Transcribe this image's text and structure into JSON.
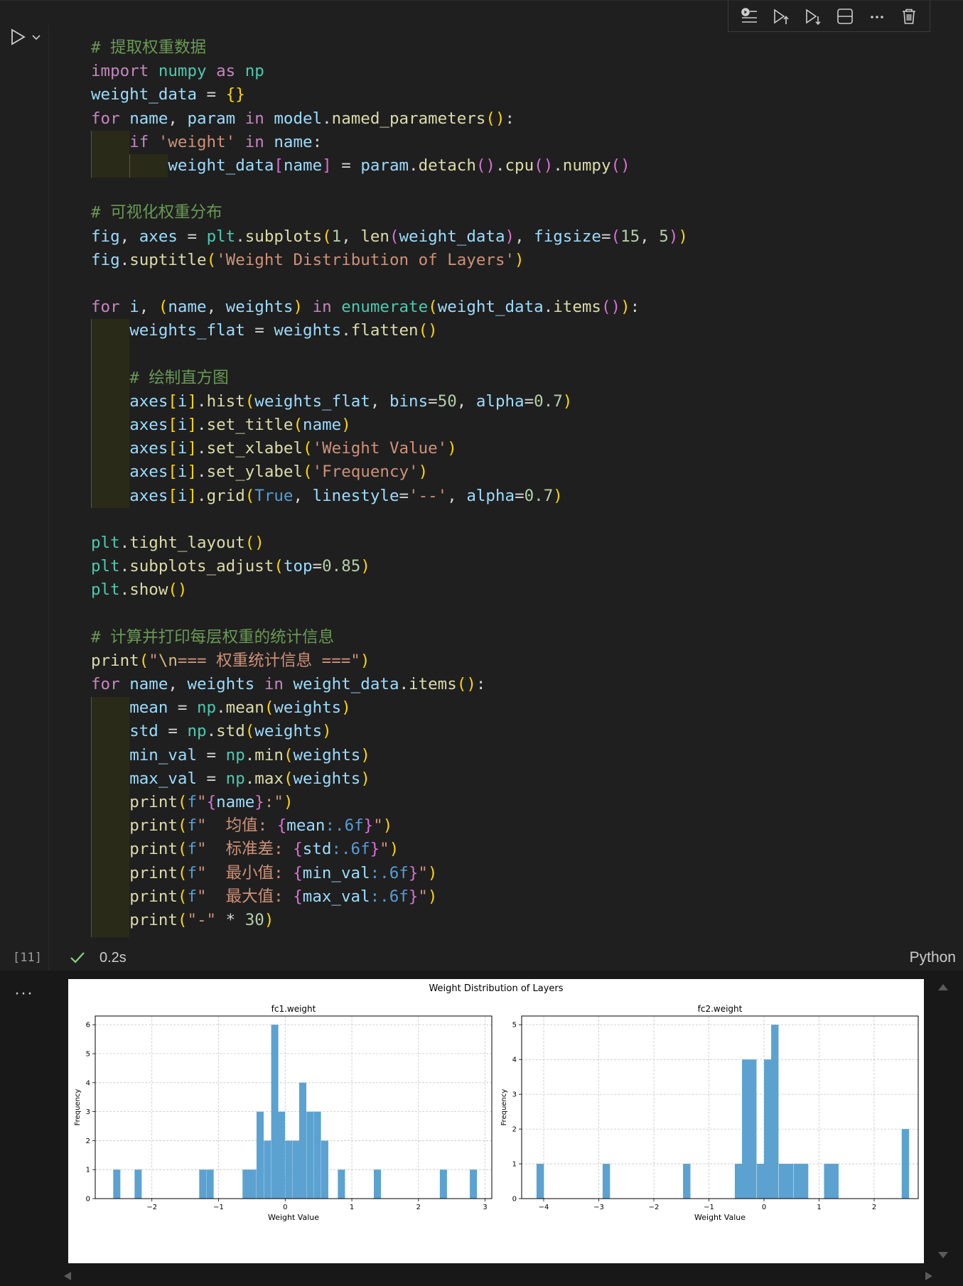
{
  "toolbar": {
    "icons": [
      "run-by-line-icon",
      "execute-above-icon",
      "execute-below-icon",
      "split-cell-icon",
      "more-icon",
      "delete-icon"
    ]
  },
  "code_lines": [
    [
      [
        "cm",
        "# 提取权重数据"
      ]
    ],
    [
      [
        "kw",
        "import"
      ],
      [
        "op",
        " "
      ],
      [
        "mod",
        "numpy"
      ],
      [
        "op",
        " "
      ],
      [
        "kw",
        "as"
      ],
      [
        "op",
        " "
      ],
      [
        "mod",
        "np"
      ]
    ],
    [
      [
        "var",
        "weight_data"
      ],
      [
        "op",
        " = "
      ],
      [
        "p1",
        "{}"
      ]
    ],
    [
      [
        "kw",
        "for"
      ],
      [
        "op",
        " "
      ],
      [
        "var",
        "name"
      ],
      [
        "op",
        ", "
      ],
      [
        "var",
        "param"
      ],
      [
        "op",
        " "
      ],
      [
        "kw",
        "in"
      ],
      [
        "op",
        " "
      ],
      [
        "var",
        "model"
      ],
      [
        "op",
        "."
      ],
      [
        "fn",
        "named_parameters"
      ],
      [
        "p1",
        "()"
      ],
      [
        "op",
        ":"
      ]
    ],
    [
      [
        "op",
        "    "
      ],
      [
        "kw",
        "if"
      ],
      [
        "op",
        " "
      ],
      [
        "str",
        "'weight'"
      ],
      [
        "op",
        " "
      ],
      [
        "kw",
        "in"
      ],
      [
        "op",
        " "
      ],
      [
        "var",
        "name"
      ],
      [
        "op",
        ":"
      ]
    ],
    [
      [
        "op",
        "        "
      ],
      [
        "var",
        "weight_data"
      ],
      [
        "p2",
        "["
      ],
      [
        "var",
        "name"
      ],
      [
        "p2",
        "]"
      ],
      [
        "op",
        " = "
      ],
      [
        "var",
        "param"
      ],
      [
        "op",
        "."
      ],
      [
        "fn",
        "detach"
      ],
      [
        "p2",
        "()"
      ],
      [
        "op",
        "."
      ],
      [
        "fn",
        "cpu"
      ],
      [
        "p2",
        "()"
      ],
      [
        "op",
        "."
      ],
      [
        "fn",
        "numpy"
      ],
      [
        "p2",
        "()"
      ]
    ],
    [],
    [
      [
        "cm",
        "# 可视化权重分布"
      ]
    ],
    [
      [
        "var",
        "fig"
      ],
      [
        "op",
        ", "
      ],
      [
        "var",
        "axes"
      ],
      [
        "op",
        " = "
      ],
      [
        "mod",
        "plt"
      ],
      [
        "op",
        "."
      ],
      [
        "fn",
        "subplots"
      ],
      [
        "p1",
        "("
      ],
      [
        "num",
        "1"
      ],
      [
        "op",
        ", "
      ],
      [
        "fn",
        "len"
      ],
      [
        "p2",
        "("
      ],
      [
        "var",
        "weight_data"
      ],
      [
        "p2",
        ")"
      ],
      [
        "op",
        ", "
      ],
      [
        "var",
        "figsize"
      ],
      [
        "op",
        "="
      ],
      [
        "p2",
        "("
      ],
      [
        "num",
        "15"
      ],
      [
        "op",
        ", "
      ],
      [
        "num",
        "5"
      ],
      [
        "p2",
        ")"
      ],
      [
        "p1",
        ")"
      ]
    ],
    [
      [
        "var",
        "fig"
      ],
      [
        "op",
        "."
      ],
      [
        "fn",
        "suptitle"
      ],
      [
        "p1",
        "("
      ],
      [
        "str",
        "'Weight Distribution of Layers'"
      ],
      [
        "p1",
        ")"
      ]
    ],
    [],
    [
      [
        "kw",
        "for"
      ],
      [
        "op",
        " "
      ],
      [
        "var",
        "i"
      ],
      [
        "op",
        ", "
      ],
      [
        "p1",
        "("
      ],
      [
        "var",
        "name"
      ],
      [
        "op",
        ", "
      ],
      [
        "var",
        "weights"
      ],
      [
        "p1",
        ")"
      ],
      [
        "op",
        " "
      ],
      [
        "kw",
        "in"
      ],
      [
        "op",
        " "
      ],
      [
        "mod",
        "enumerate"
      ],
      [
        "p1",
        "("
      ],
      [
        "var",
        "weight_data"
      ],
      [
        "op",
        "."
      ],
      [
        "fn",
        "items"
      ],
      [
        "p2",
        "()"
      ],
      [
        "p1",
        ")"
      ],
      [
        "op",
        ":"
      ]
    ],
    [
      [
        "op",
        "    "
      ],
      [
        "var",
        "weights_flat"
      ],
      [
        "op",
        " = "
      ],
      [
        "var",
        "weights"
      ],
      [
        "op",
        "."
      ],
      [
        "fn",
        "flatten"
      ],
      [
        "p1",
        "()"
      ]
    ],
    [],
    [
      [
        "op",
        "    "
      ],
      [
        "cm",
        "# 绘制直方图"
      ]
    ],
    [
      [
        "op",
        "    "
      ],
      [
        "var",
        "axes"
      ],
      [
        "p1",
        "["
      ],
      [
        "var",
        "i"
      ],
      [
        "p1",
        "]"
      ],
      [
        "op",
        "."
      ],
      [
        "fn",
        "hist"
      ],
      [
        "p1",
        "("
      ],
      [
        "var",
        "weights_flat"
      ],
      [
        "op",
        ", "
      ],
      [
        "var",
        "bins"
      ],
      [
        "op",
        "="
      ],
      [
        "num",
        "50"
      ],
      [
        "op",
        ", "
      ],
      [
        "var",
        "alpha"
      ],
      [
        "op",
        "="
      ],
      [
        "num",
        "0.7"
      ],
      [
        "p1",
        ")"
      ]
    ],
    [
      [
        "op",
        "    "
      ],
      [
        "var",
        "axes"
      ],
      [
        "p1",
        "["
      ],
      [
        "var",
        "i"
      ],
      [
        "p1",
        "]"
      ],
      [
        "op",
        "."
      ],
      [
        "fn",
        "set_title"
      ],
      [
        "p1",
        "("
      ],
      [
        "var",
        "name"
      ],
      [
        "p1",
        ")"
      ]
    ],
    [
      [
        "op",
        "    "
      ],
      [
        "var",
        "axes"
      ],
      [
        "p1",
        "["
      ],
      [
        "var",
        "i"
      ],
      [
        "p1",
        "]"
      ],
      [
        "op",
        "."
      ],
      [
        "fn",
        "set_xlabel"
      ],
      [
        "p1",
        "("
      ],
      [
        "str",
        "'Weight Value'"
      ],
      [
        "p1",
        ")"
      ]
    ],
    [
      [
        "op",
        "    "
      ],
      [
        "var",
        "axes"
      ],
      [
        "p1",
        "["
      ],
      [
        "var",
        "i"
      ],
      [
        "p1",
        "]"
      ],
      [
        "op",
        "."
      ],
      [
        "fn",
        "set_ylabel"
      ],
      [
        "p1",
        "("
      ],
      [
        "str",
        "'Frequency'"
      ],
      [
        "p1",
        ")"
      ]
    ],
    [
      [
        "op",
        "    "
      ],
      [
        "var",
        "axes"
      ],
      [
        "p1",
        "["
      ],
      [
        "var",
        "i"
      ],
      [
        "p1",
        "]"
      ],
      [
        "op",
        "."
      ],
      [
        "fn",
        "grid"
      ],
      [
        "p1",
        "("
      ],
      [
        "kwb",
        "True"
      ],
      [
        "op",
        ", "
      ],
      [
        "var",
        "linestyle"
      ],
      [
        "op",
        "="
      ],
      [
        "str",
        "'--'"
      ],
      [
        "op",
        ", "
      ],
      [
        "var",
        "alpha"
      ],
      [
        "op",
        "="
      ],
      [
        "num",
        "0.7"
      ],
      [
        "p1",
        ")"
      ]
    ],
    [],
    [
      [
        "mod",
        "plt"
      ],
      [
        "op",
        "."
      ],
      [
        "fn",
        "tight_layout"
      ],
      [
        "p1",
        "()"
      ]
    ],
    [
      [
        "mod",
        "plt"
      ],
      [
        "op",
        "."
      ],
      [
        "fn",
        "subplots_adjust"
      ],
      [
        "p1",
        "("
      ],
      [
        "var",
        "top"
      ],
      [
        "op",
        "="
      ],
      [
        "num",
        "0.85"
      ],
      [
        "p1",
        ")"
      ]
    ],
    [
      [
        "mod",
        "plt"
      ],
      [
        "op",
        "."
      ],
      [
        "fn",
        "show"
      ],
      [
        "p1",
        "()"
      ]
    ],
    [],
    [
      [
        "cm",
        "# 计算并打印每层权重的统计信息"
      ]
    ],
    [
      [
        "fn",
        "print"
      ],
      [
        "p1",
        "("
      ],
      [
        "str",
        "\""
      ],
      [
        "esc",
        "\\n"
      ],
      [
        "str",
        "=== 权重统计信息 ===\""
      ],
      [
        "p1",
        ")"
      ]
    ],
    [
      [
        "kw",
        "for"
      ],
      [
        "op",
        " "
      ],
      [
        "var",
        "name"
      ],
      [
        "op",
        ", "
      ],
      [
        "var",
        "weights"
      ],
      [
        "op",
        " "
      ],
      [
        "kw",
        "in"
      ],
      [
        "op",
        " "
      ],
      [
        "var",
        "weight_data"
      ],
      [
        "op",
        "."
      ],
      [
        "fn",
        "items"
      ],
      [
        "p1",
        "()"
      ],
      [
        "op",
        ":"
      ]
    ],
    [
      [
        "op",
        "    "
      ],
      [
        "var",
        "mean"
      ],
      [
        "op",
        " = "
      ],
      [
        "mod",
        "np"
      ],
      [
        "op",
        "."
      ],
      [
        "fn",
        "mean"
      ],
      [
        "p1",
        "("
      ],
      [
        "var",
        "weights"
      ],
      [
        "p1",
        ")"
      ]
    ],
    [
      [
        "op",
        "    "
      ],
      [
        "var",
        "std"
      ],
      [
        "op",
        " = "
      ],
      [
        "mod",
        "np"
      ],
      [
        "op",
        "."
      ],
      [
        "fn",
        "std"
      ],
      [
        "p1",
        "("
      ],
      [
        "var",
        "weights"
      ],
      [
        "p1",
        ")"
      ]
    ],
    [
      [
        "op",
        "    "
      ],
      [
        "var",
        "min_val"
      ],
      [
        "op",
        " = "
      ],
      [
        "mod",
        "np"
      ],
      [
        "op",
        "."
      ],
      [
        "fn",
        "min"
      ],
      [
        "p1",
        "("
      ],
      [
        "var",
        "weights"
      ],
      [
        "p1",
        ")"
      ]
    ],
    [
      [
        "op",
        "    "
      ],
      [
        "var",
        "max_val"
      ],
      [
        "op",
        " = "
      ],
      [
        "mod",
        "np"
      ],
      [
        "op",
        "."
      ],
      [
        "fn",
        "max"
      ],
      [
        "p1",
        "("
      ],
      [
        "var",
        "weights"
      ],
      [
        "p1",
        ")"
      ]
    ],
    [
      [
        "op",
        "    "
      ],
      [
        "fn",
        "print"
      ],
      [
        "p1",
        "("
      ],
      [
        "kwb",
        "f"
      ],
      [
        "str",
        "\""
      ],
      [
        "p2",
        "{"
      ],
      [
        "var",
        "name"
      ],
      [
        "p2",
        "}"
      ],
      [
        "str",
        ":\""
      ],
      [
        "p1",
        ")"
      ]
    ],
    [
      [
        "op",
        "    "
      ],
      [
        "fn",
        "print"
      ],
      [
        "p1",
        "("
      ],
      [
        "kwb",
        "f"
      ],
      [
        "str",
        "\"  均值: "
      ],
      [
        "p2",
        "{"
      ],
      [
        "var",
        "mean"
      ],
      [
        "kwb",
        ":.6f"
      ],
      [
        "p2",
        "}"
      ],
      [
        "str",
        "\""
      ],
      [
        "p1",
        ")"
      ]
    ],
    [
      [
        "op",
        "    "
      ],
      [
        "fn",
        "print"
      ],
      [
        "p1",
        "("
      ],
      [
        "kwb",
        "f"
      ],
      [
        "str",
        "\"  标准差: "
      ],
      [
        "p2",
        "{"
      ],
      [
        "var",
        "std"
      ],
      [
        "kwb",
        ":.6f"
      ],
      [
        "p2",
        "}"
      ],
      [
        "str",
        "\""
      ],
      [
        "p1",
        ")"
      ]
    ],
    [
      [
        "op",
        "    "
      ],
      [
        "fn",
        "print"
      ],
      [
        "p1",
        "("
      ],
      [
        "kwb",
        "f"
      ],
      [
        "str",
        "\"  最小值: "
      ],
      [
        "p2",
        "{"
      ],
      [
        "var",
        "min_val"
      ],
      [
        "kwb",
        ":.6f"
      ],
      [
        "p2",
        "}"
      ],
      [
        "str",
        "\""
      ],
      [
        "p1",
        ")"
      ]
    ],
    [
      [
        "op",
        "    "
      ],
      [
        "fn",
        "print"
      ],
      [
        "p1",
        "("
      ],
      [
        "kwb",
        "f"
      ],
      [
        "str",
        "\"  最大值: "
      ],
      [
        "p2",
        "{"
      ],
      [
        "var",
        "max_val"
      ],
      [
        "kwb",
        ":.6f"
      ],
      [
        "p2",
        "}"
      ],
      [
        "str",
        "\""
      ],
      [
        "p1",
        ")"
      ]
    ],
    [
      [
        "op",
        "    "
      ],
      [
        "fn",
        "print"
      ],
      [
        "p1",
        "("
      ],
      [
        "str",
        "\"-\""
      ],
      [
        "op",
        " * "
      ],
      [
        "num",
        "30"
      ],
      [
        "p1",
        ")"
      ]
    ]
  ],
  "cell_status": {
    "execution_count": "[11]",
    "duration": "0.2s",
    "language": "Python",
    "output_more": "···"
  },
  "chart_data": {
    "suptitle": "Weight Distribution of Layers",
    "subplots": [
      {
        "type": "bar",
        "title": "fc1.weight",
        "xlabel": "Weight Value",
        "ylabel": "Frequency",
        "xlim": [
          -2.85,
          3.1
        ],
        "ylim": [
          0,
          6.3
        ],
        "xticks": [
          -2,
          -1,
          0,
          1,
          2,
          3
        ],
        "yticks": [
          0,
          1,
          2,
          3,
          4,
          5,
          6
        ],
        "grid": true,
        "color": "#5ba2d1",
        "bin_width": 0.107,
        "bars": [
          {
            "x": -2.58,
            "h": 1
          },
          {
            "x": -2.26,
            "h": 1
          },
          {
            "x": -1.29,
            "h": 1
          },
          {
            "x": -1.18,
            "h": 1
          },
          {
            "x": -0.64,
            "h": 1
          },
          {
            "x": -0.54,
            "h": 1
          },
          {
            "x": -0.43,
            "h": 3
          },
          {
            "x": -0.32,
            "h": 2
          },
          {
            "x": -0.21,
            "h": 6
          },
          {
            "x": -0.11,
            "h": 3
          },
          {
            "x": 0.0,
            "h": 2
          },
          {
            "x": 0.11,
            "h": 2
          },
          {
            "x": 0.21,
            "h": 4
          },
          {
            "x": 0.32,
            "h": 3
          },
          {
            "x": 0.43,
            "h": 3
          },
          {
            "x": 0.54,
            "h": 2
          },
          {
            "x": 0.79,
            "h": 1
          },
          {
            "x": 1.33,
            "h": 1
          },
          {
            "x": 2.32,
            "h": 1
          },
          {
            "x": 2.77,
            "h": 1
          }
        ]
      },
      {
        "type": "bar",
        "title": "fc2.weight",
        "xlabel": "Weight Value",
        "ylabel": "Frequency",
        "xlim": [
          -4.4,
          2.8
        ],
        "ylim": [
          0,
          5.25
        ],
        "xticks": [
          -4,
          -3,
          -2,
          -1,
          0,
          1,
          2
        ],
        "yticks": [
          0,
          1,
          2,
          3,
          4,
          5
        ],
        "grid": true,
        "color": "#5ba2d1",
        "bin_width": 0.134,
        "bars": [
          {
            "x": -4.13,
            "h": 1
          },
          {
            "x": -2.93,
            "h": 1
          },
          {
            "x": -1.47,
            "h": 1
          },
          {
            "x": -0.53,
            "h": 1
          },
          {
            "x": -0.4,
            "h": 4
          },
          {
            "x": -0.27,
            "h": 4
          },
          {
            "x": -0.13,
            "h": 1
          },
          {
            "x": 0.0,
            "h": 4
          },
          {
            "x": 0.13,
            "h": 5
          },
          {
            "x": 0.27,
            "h": 1
          },
          {
            "x": 0.4,
            "h": 1
          },
          {
            "x": 0.54,
            "h": 1
          },
          {
            "x": 0.67,
            "h": 1
          },
          {
            "x": 1.09,
            "h": 1
          },
          {
            "x": 1.22,
            "h": 1
          },
          {
            "x": 2.5,
            "h": 2
          }
        ]
      }
    ]
  }
}
